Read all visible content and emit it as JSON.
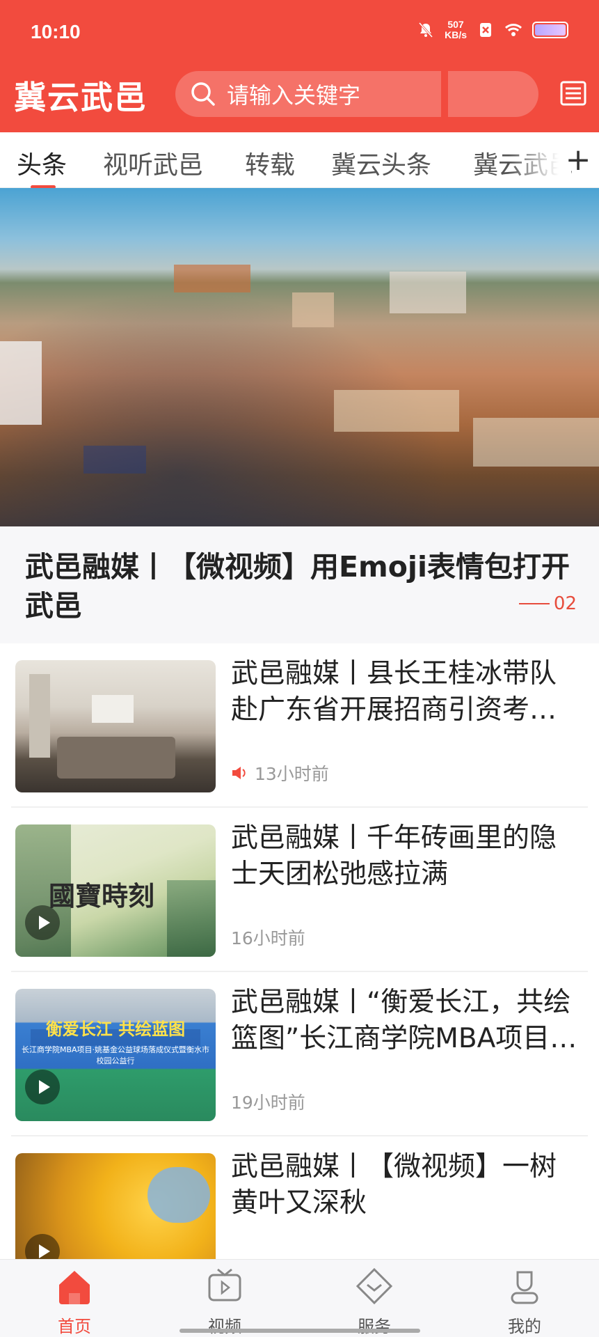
{
  "status_bar": {
    "time": "10:10",
    "net_speed_value": "507",
    "net_speed_unit": "KB/s"
  },
  "header": {
    "app_name": "冀云武邑",
    "search_placeholder": "请输入关键字"
  },
  "tabs": [
    {
      "label": "头条",
      "active": true
    },
    {
      "label": "视听武邑",
      "active": false
    },
    {
      "label": "转载",
      "active": false
    },
    {
      "label": "冀云头条",
      "active": false
    },
    {
      "label": "冀云武邑",
      "active": false
    }
  ],
  "tab_add_label": "+",
  "hero": {
    "title": "武邑融媒丨【微视频】用Emoji表情包打开武邑",
    "page_indicator": "02"
  },
  "news": [
    {
      "title": "武邑融媒丨县长王桂冰带队赴广东省开展招商引资考察活动",
      "time": "13小时前",
      "has_audio": true,
      "has_video": false,
      "thumb": "meeting-room"
    },
    {
      "title": "武邑融媒丨千年砖画里的隐士天团松弛感拉满",
      "time": "16小时前",
      "has_audio": false,
      "has_video": true,
      "thumb": "guobao-shike",
      "thumb_text": "國寶時刻"
    },
    {
      "title": "武邑融媒丨“衡爱长江，共绘篮图”长江商学院MBA项目·姚基金公益球场落成仪式",
      "time": "19小时前",
      "has_audio": false,
      "has_video": true,
      "thumb": "basketball-court",
      "thumb_text": "衡爱长江 共绘蓝图",
      "thumb_subtext": "长江商学院MBA项目·姚基金公益球场落成仪式暨衡水市校园公益行"
    },
    {
      "title": "武邑融媒丨【微视频】一树黄叶又深秋",
      "time": "",
      "has_audio": false,
      "has_video": true,
      "thumb": "yellow-leaves"
    }
  ],
  "bottom_nav": [
    {
      "label": "首页",
      "icon": "home-icon",
      "active": true
    },
    {
      "label": "视频",
      "icon": "tv-icon",
      "active": false
    },
    {
      "label": "服务",
      "icon": "service-icon",
      "active": false
    },
    {
      "label": "我的",
      "icon": "user-icon",
      "active": false
    }
  ],
  "colors": {
    "brand": "#f24b3e",
    "accent_text": "#e74c3c"
  }
}
